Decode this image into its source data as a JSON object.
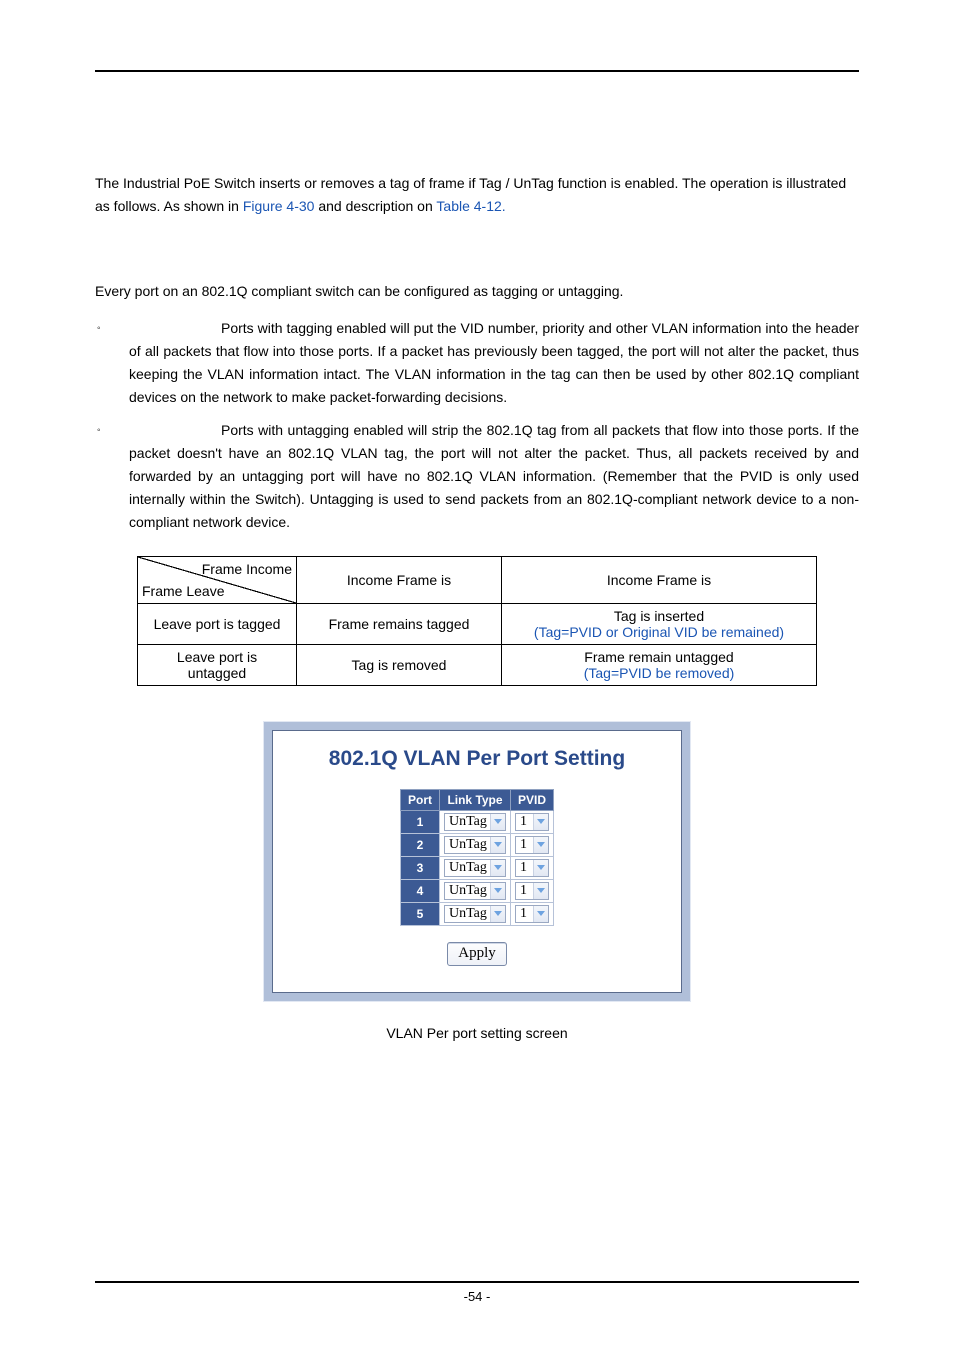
{
  "page_number_label": "-54 -",
  "intro_before_link1": "The Industrial PoE Switch inserts or removes a tag of frame if Tag / UnTag function is enabled. The operation is illustrated as follows. As shown in ",
  "intro_link1": "Figure 4-30",
  "intro_mid": " and description on ",
  "intro_link2": "Table 4-12.",
  "lead_sentence": "Every port on an 802.1Q compliant switch can be configured as tagging or untagging.",
  "bullets": [
    "Ports with tagging enabled will put the VID number, priority and other VLAN information into the header of all packets that flow into those ports. If a packet has previously been tagged, the port will not alter the packet, thus keeping the VLAN information intact. The VLAN information in the tag can then be used by other 802.1Q compliant devices on the network to make packet-forwarding decisions.",
    "Ports with untagging enabled will strip the 802.1Q tag from all packets that flow into those ports. If the packet doesn't have an 802.1Q VLAN tag, the port will not alter the packet. Thus, all packets received by and forwarded by an untagging port will have no 802.1Q VLAN information. (Remember that the PVID is only used internally within the Switch). Untagging is used to send packets from an 802.1Q-compliant network device to a non-compliant network device."
  ],
  "frame_table": {
    "diag_top": "Frame Income",
    "diag_bottom": "Frame Leave",
    "col_b_header": "Income Frame is",
    "col_c_header": "Income Frame is",
    "rows": [
      {
        "leave": "Leave port is tagged",
        "col_b": "Frame remains tagged",
        "col_c_line1": "Tag is inserted",
        "col_c_line2": "(Tag=PVID or Original VID be remained)"
      },
      {
        "leave": "Leave port is untagged",
        "col_b": "Tag is removed",
        "col_c_line1": "Frame remain untagged",
        "col_c_line2": "(Tag=PVID be removed)"
      }
    ]
  },
  "panel": {
    "title": "802.1Q VLAN Per Port Setting",
    "headers": {
      "port": "Port",
      "link_type": "Link Type",
      "pvid": "PVID"
    },
    "rows": [
      {
        "port": "1",
        "link_type": "UnTag",
        "pvid": "1"
      },
      {
        "port": "2",
        "link_type": "UnTag",
        "pvid": "1"
      },
      {
        "port": "3",
        "link_type": "UnTag",
        "pvid": "1"
      },
      {
        "port": "4",
        "link_type": "UnTag",
        "pvid": "1"
      },
      {
        "port": "5",
        "link_type": "UnTag",
        "pvid": "1"
      }
    ],
    "apply_label": "Apply"
  },
  "caption": "VLAN Per port setting screen"
}
